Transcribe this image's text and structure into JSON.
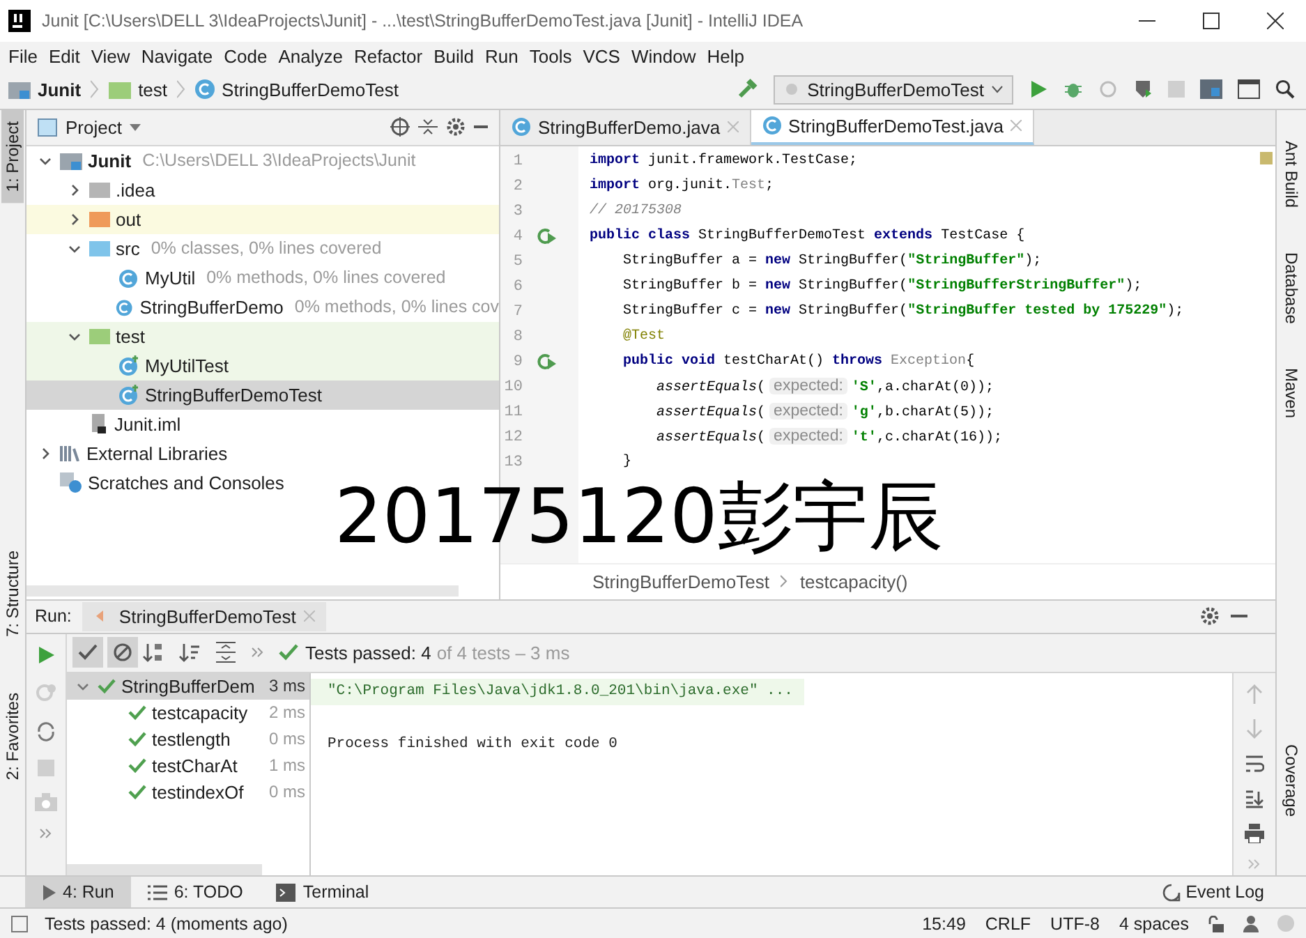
{
  "window": {
    "title": "Junit [C:\\Users\\DELL 3\\IdeaProjects\\Junit] - ...\\test\\StringBufferDemoTest.java [Junit] - IntelliJ IDEA"
  },
  "menu": [
    "File",
    "Edit",
    "View",
    "Navigate",
    "Code",
    "Analyze",
    "Refactor",
    "Build",
    "Run",
    "Tools",
    "VCS",
    "Window",
    "Help"
  ],
  "navbar": {
    "crumbs": [
      {
        "kind": "module",
        "label": "Junit"
      },
      {
        "kind": "test-folder",
        "label": "test"
      },
      {
        "kind": "class",
        "label": "StringBufferDemoTest"
      }
    ],
    "run_config": "StringBufferDemoTest"
  },
  "left_strip": [
    {
      "label": "1: Project",
      "selected": true
    },
    {
      "label": "7: Structure",
      "selected": false
    },
    {
      "label": "2: Favorites",
      "selected": false
    }
  ],
  "right_strip": [
    "Ant Build",
    "Database",
    "Maven",
    "Coverage"
  ],
  "project": {
    "title": "Project",
    "tree": [
      {
        "kind": "module",
        "label": "Junit",
        "note": "C:\\Users\\DELL 3\\IdeaProjects\\Junit",
        "expanded": true,
        "selected": false,
        "children": [
          {
            "kind": "folder",
            "label": ".idea",
            "expanded": false,
            "selected": false
          },
          {
            "kind": "excluded-folder",
            "label": "out",
            "expanded": false,
            "selected": false
          },
          {
            "kind": "source-folder",
            "label": "src",
            "note": "0% classes, 0% lines covered",
            "expanded": true,
            "selected": false,
            "children": [
              {
                "kind": "class",
                "label": "MyUtil",
                "note": "0% methods, 0% lines covered",
                "selected": false
              },
              {
                "kind": "class",
                "label": "StringBufferDemo",
                "note": "0% methods, 0% lines cov",
                "selected": false
              }
            ]
          },
          {
            "kind": "test-folder",
            "label": "test",
            "expanded": true,
            "selected": false,
            "children": [
              {
                "kind": "test-class",
                "label": "MyUtilTest",
                "selected": false
              },
              {
                "kind": "test-class",
                "label": "StringBufferDemoTest",
                "selected": true
              }
            ]
          },
          {
            "kind": "iml",
            "label": "Junit.iml",
            "selected": false
          }
        ]
      },
      {
        "kind": "library",
        "label": "External Libraries",
        "expanded": false,
        "selected": false
      },
      {
        "kind": "scratches",
        "label": "Scratches and Consoles",
        "selected": false
      }
    ]
  },
  "editor": {
    "tabs": [
      {
        "label": "StringBufferDemo.java",
        "selected": false
      },
      {
        "label": "StringBufferDemoTest.java",
        "selected": true
      }
    ],
    "lines": [
      {
        "n": "1",
        "run": false,
        "segs": [
          {
            "kind": "kw",
            "t": "import"
          },
          {
            "kind": "p",
            "t": " junit.framework.TestCase;"
          }
        ]
      },
      {
        "n": "2",
        "run": false,
        "segs": [
          {
            "kind": "kw",
            "t": "import"
          },
          {
            "kind": "p",
            "t": " org.junit."
          },
          {
            "kind": "dim",
            "t": "Test"
          },
          {
            "kind": "p",
            "t": ";"
          }
        ]
      },
      {
        "n": "3",
        "run": false,
        "segs": [
          {
            "kind": "cm",
            "t": "// 20175308"
          }
        ]
      },
      {
        "n": "4",
        "run": true,
        "segs": [
          {
            "kind": "kw",
            "t": "public class"
          },
          {
            "kind": "p",
            "t": " StringBufferDemoTest "
          },
          {
            "kind": "kw",
            "t": "extends"
          },
          {
            "kind": "p",
            "t": " TestCase {"
          }
        ]
      },
      {
        "n": "5",
        "run": false,
        "segs": [
          {
            "kind": "p",
            "t": "    StringBuffer a = "
          },
          {
            "kind": "kw",
            "t": "new"
          },
          {
            "kind": "p",
            "t": " StringBuffer("
          },
          {
            "kind": "str",
            "t": "\"StringBuffer\""
          },
          {
            "kind": "p",
            "t": ");"
          }
        ]
      },
      {
        "n": "6",
        "run": false,
        "segs": [
          {
            "kind": "p",
            "t": "    StringBuffer b = "
          },
          {
            "kind": "kw",
            "t": "new"
          },
          {
            "kind": "p",
            "t": " StringBuffer("
          },
          {
            "kind": "str",
            "t": "\"StringBufferStringBuffer\""
          },
          {
            "kind": "p",
            "t": ");"
          }
        ]
      },
      {
        "n": "7",
        "run": false,
        "segs": [
          {
            "kind": "p",
            "t": "    StringBuffer c = "
          },
          {
            "kind": "kw",
            "t": "new"
          },
          {
            "kind": "p",
            "t": " StringBuffer("
          },
          {
            "kind": "str",
            "t": "\"StringBuffer tested by 175229\""
          },
          {
            "kind": "p",
            "t": ");"
          }
        ]
      },
      {
        "n": "8",
        "run": false,
        "segs": [
          {
            "kind": "ann",
            "t": "    @Test"
          }
        ]
      },
      {
        "n": "9",
        "run": true,
        "segs": [
          {
            "kind": "kw",
            "t": "    public void"
          },
          {
            "kind": "p",
            "t": " testCharAt() "
          },
          {
            "kind": "kw",
            "t": "throws"
          },
          {
            "kind": "dim",
            "t": " Exception"
          },
          {
            "kind": "p",
            "t": "{"
          }
        ]
      },
      {
        "n": "10",
        "run": false,
        "segs": [
          {
            "kind": "it",
            "t": "        assertEquals"
          },
          {
            "kind": "p",
            "t": "("
          },
          {
            "kind": "hint",
            "t": "expected:"
          },
          {
            "kind": "str",
            "t": "'S'"
          },
          {
            "kind": "p",
            "t": ",a.charAt(0));"
          }
        ]
      },
      {
        "n": "11",
        "run": false,
        "segs": [
          {
            "kind": "it",
            "t": "        assertEquals"
          },
          {
            "kind": "p",
            "t": "("
          },
          {
            "kind": "hint",
            "t": "expected:"
          },
          {
            "kind": "str",
            "t": "'g'"
          },
          {
            "kind": "p",
            "t": ",b.charAt(5));"
          }
        ]
      },
      {
        "n": "12",
        "run": false,
        "segs": [
          {
            "kind": "it",
            "t": "        assertEquals"
          },
          {
            "kind": "p",
            "t": "("
          },
          {
            "kind": "hint",
            "t": "expected:"
          },
          {
            "kind": "str",
            "t": "'t'"
          },
          {
            "kind": "p",
            "t": ",c.charAt(16));"
          }
        ]
      },
      {
        "n": "13",
        "run": false,
        "segs": [
          {
            "kind": "p",
            "t": "    }"
          }
        ]
      }
    ],
    "breadcrumbs": [
      "StringBufferDemoTest",
      "testcapacity()"
    ]
  },
  "run": {
    "label": "Run:",
    "tab": "StringBufferDemoTest",
    "status": "Tests passed: 4",
    "status_detail": "of 4 tests – 3 ms",
    "tests": [
      {
        "name": "StringBufferDem",
        "time": "3 ms",
        "passed": true,
        "expanded": true,
        "selected": true,
        "children": [
          {
            "name": "testcapacity",
            "time": "2 ms",
            "passed": true,
            "selected": false
          },
          {
            "name": "testlength",
            "time": "0 ms",
            "passed": true,
            "selected": false
          },
          {
            "name": "testCharAt",
            "time": "1 ms",
            "passed": true,
            "selected": false
          },
          {
            "name": "testindexOf",
            "time": "0 ms",
            "passed": true,
            "selected": false
          }
        ]
      }
    ],
    "console": [
      "\"C:\\Program Files\\Java\\jdk1.8.0_201\\bin\\java.exe\" ...",
      "Process finished with exit code 0"
    ]
  },
  "tool_tabs": [
    {
      "label": "4: Run",
      "kind": "run",
      "selected": true
    },
    {
      "label": "6: TODO",
      "kind": "todo",
      "selected": false
    },
    {
      "label": "Terminal",
      "kind": "terminal",
      "selected": false
    }
  ],
  "event_log": "Event Log",
  "status_bar": {
    "message": "Tests passed: 4 (moments ago)",
    "items": [
      "15:49",
      "CRLF",
      "UTF-8",
      "4 spaces"
    ]
  },
  "overlay": "20175120彭宇辰"
}
